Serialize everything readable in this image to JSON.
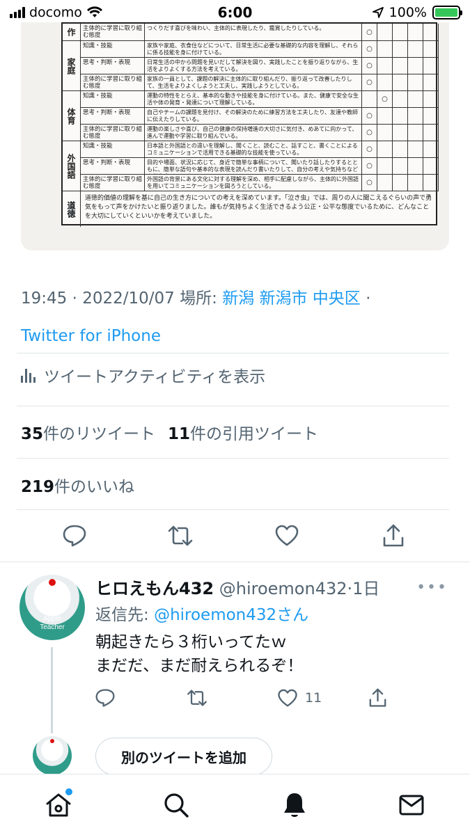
{
  "status_bar": {
    "carrier": "docomo",
    "time": "6:00",
    "battery": "100%"
  },
  "photo_table": {
    "rows": [
      {
        "subject": "作",
        "criterion": "主体的に学習に取り組む態度",
        "desc": "つくりだす喜びを味わい、主体的に表現したり、鑑賞したりしている。",
        "mark_col": 0
      },
      {
        "subject": "家庭",
        "criterion": "知識・技能",
        "desc": "家族や家庭、衣食住などについて、日常生活に必要な基礎的な内容を理解し、それらに係る技能を身に付けている。",
        "mark_col": 0
      },
      {
        "subject": "",
        "criterion": "思考・判断・表現",
        "desc": "日常生活の中から問題を見いだして解決を図り、実践したことを振り返りながら、生活をよりよくする方法を考えている。",
        "mark_col": 0
      },
      {
        "subject": "",
        "criterion": "主体的に学習に取り組む態度",
        "desc": "家族の一員として、課題の解決に主体的に取り組んだり、振り返って改善したりして、生活をよりよくしようと工夫し、実践しようとしている。",
        "mark_col": 0
      },
      {
        "subject": "体育",
        "criterion": "知識・技能",
        "desc": "運動の特性をとらえ、基本的な動きや技能を身に付けている。また、健康で安全な生活や体の発育・発達について理解している。",
        "mark_col": 1
      },
      {
        "subject": "",
        "criterion": "思考・判断・表現",
        "desc": "自己やチームの課題を見付け、その解決のために練習方法を工夫したり、友達や教師に伝えたりしている。",
        "mark_col": 0
      },
      {
        "subject": "",
        "criterion": "主体的に学習に取り組む態度",
        "desc": "運動の楽しさや喜び、自己の健康の保持増進の大切さに気付き、めあてに向かって、進んで運動や学習に取り組んでいる。",
        "mark_col": 0
      },
      {
        "subject": "外国語",
        "criterion": "知識・技能",
        "desc": "日本語と外国語との違いを理解し、聞くこと、読むこと、話すこと、書くことによるコミュニケーションで活用できる基礎的な技能を使っている。",
        "mark_col": 0
      },
      {
        "subject": "",
        "criterion": "思考・判断・表現",
        "desc": "目的や場面、状況に応じて、身近で簡単な事柄について、聞いたり話したりするとともに、簡単な語句や基本的な表現を読んだり書いたりして、自分の考えや気持ちなどを伝え合っている。",
        "mark_col": 0
      },
      {
        "subject": "",
        "criterion": "主体的に学習に取り組む態度",
        "desc": "外国語の背景にある文化に対する理解を深め、相手に配慮しながら、主体的に外国語を用いてコミュニケーションを図ろうとしている。",
        "mark_col": 0
      }
    ],
    "mark": "○",
    "moral_label": "道徳",
    "moral_text": "道徳的価値の理解を基に自己の生き方についての考えを深めています。「泣き虫」では、周りの人に聞こえるぐらいの声で勇気をもって声をかけたいと振り返りました。誰もが気持ちよく生活できるよう公正・公平な態度でいるために、どんなことを大切にしていくといいかを考えていました。"
  },
  "tweet_meta": {
    "time": "19:45",
    "date": "2022/10/07",
    "location_label": "場所:",
    "location": "新潟 新潟市 中央区",
    "source": "Twitter for iPhone"
  },
  "activity_label": "ツイートアクティビティを表示",
  "stats": {
    "retweets": "35",
    "retweets_label": "件のリツイート",
    "quotes": "11",
    "quotes_label": "件の引用ツイート",
    "likes": "219",
    "likes_label": "件のいいね"
  },
  "reply": {
    "name": "ヒロえもん432",
    "handle": "@hiroemon432",
    "age": "1日",
    "replying_to_label": "返信先:",
    "replying_to": "@hiroemon432",
    "replying_to_suffix": "さん",
    "text": "朝起きたら３桁いってたｗ\nまだだ、まだ耐えられるぞ！",
    "like_count": "11",
    "avatar_text": "Apple\nTeacher"
  },
  "add_tweet_label": "別のツイートを追加",
  "colors": {
    "accent": "#1d9bf0",
    "muted": "#536471",
    "battery": "#35c759"
  },
  "icons": [
    "wifi-icon",
    "location-arrow-icon",
    "bar-chart-icon",
    "reply-icon",
    "retweet-icon",
    "heart-icon",
    "share-icon",
    "more-icon",
    "home-icon",
    "search-icon",
    "bell-icon",
    "mail-icon"
  ]
}
